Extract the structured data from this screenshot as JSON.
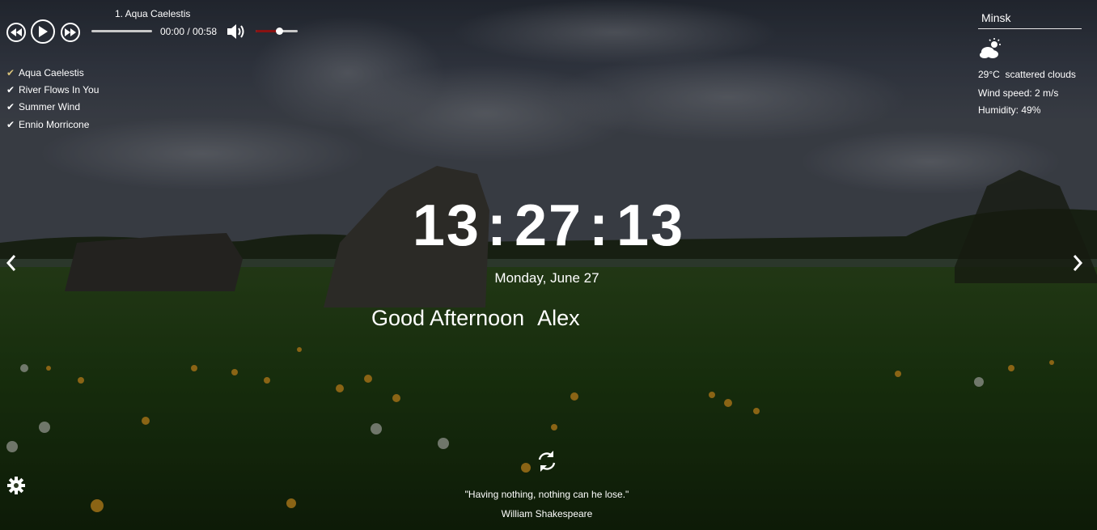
{
  "player": {
    "current_track": "1. Aqua Caelestis",
    "time": "00:00 / 00:58",
    "progress_fraction": 0,
    "volume_fraction": 0.55,
    "colors": {
      "volume_fill": "#8a1212"
    },
    "icons": [
      "previous-icon",
      "play-icon",
      "next-icon",
      "volume-icon"
    ]
  },
  "playlist": [
    {
      "label": "Aqua Caelestis",
      "active": true
    },
    {
      "label": "River Flows In You",
      "active": false
    },
    {
      "label": "Summer Wind",
      "active": false
    },
    {
      "label": "Ennio Morricone",
      "active": false
    }
  ],
  "weather": {
    "city": "Minsk",
    "temperature": "29°C",
    "description": "scattered clouds",
    "wind": "Wind speed: 2 m/s",
    "humidity": "Humidity: 49%",
    "icon": "partly-cloudy-icon"
  },
  "clock": {
    "hours": "13",
    "minutes": "27",
    "seconds": "13"
  },
  "date": "Monday, June 27",
  "greeting": {
    "text": "Good Afternoon",
    "name": "Alex"
  },
  "quote": {
    "text": "\"Having nothing, nothing can he lose.\"",
    "author": "William Shakespeare"
  },
  "icons": {
    "prev_slide": "chevron-left-icon",
    "next_slide": "chevron-right-icon",
    "refresh": "refresh-icon",
    "settings": "gear-icon"
  },
  "colors": {
    "accent_check": "#d9c27a",
    "text": "#ffffff"
  }
}
